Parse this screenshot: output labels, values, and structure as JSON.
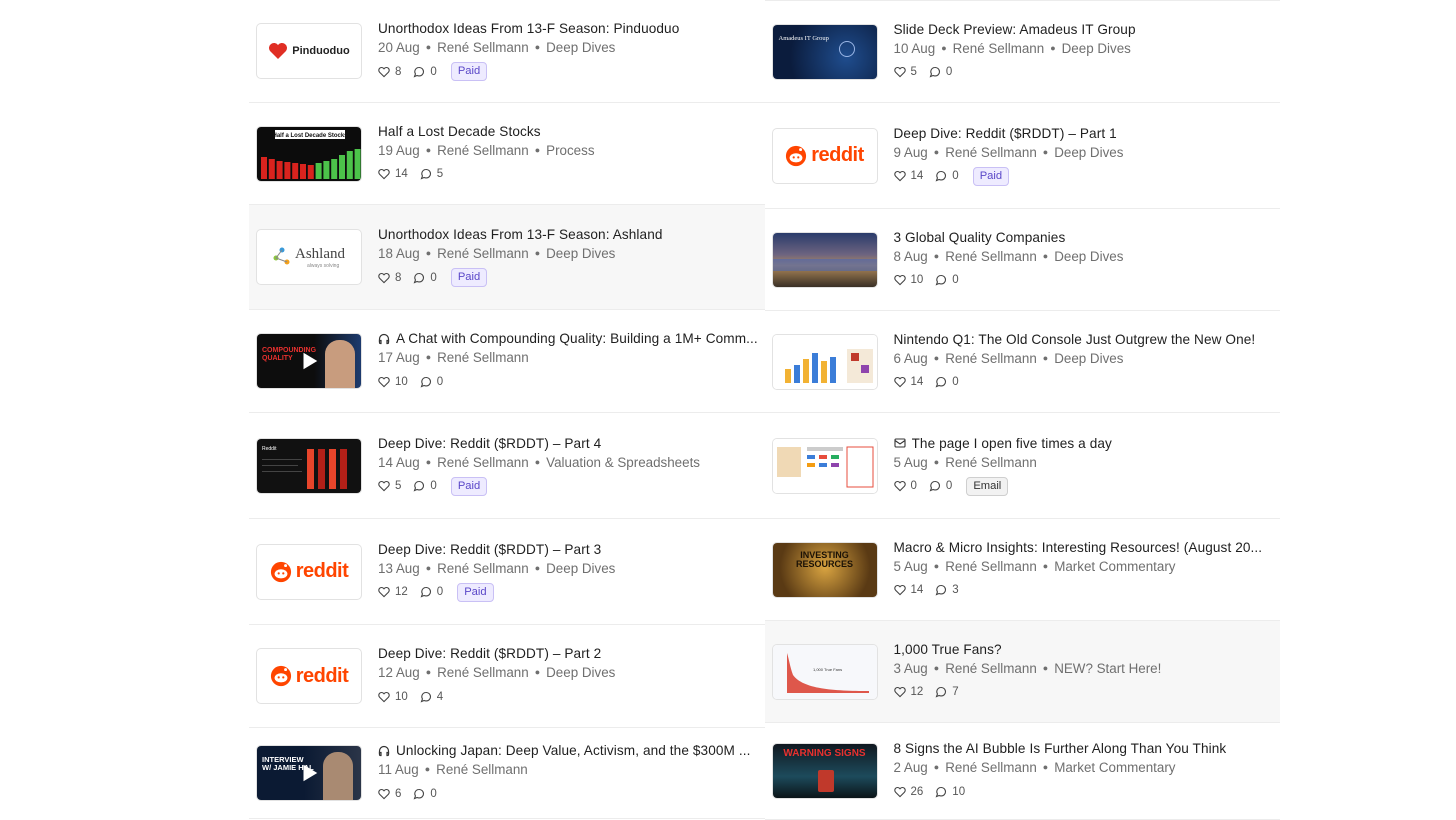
{
  "colors": {
    "paid_badge_bg": "#eeebff",
    "paid_badge_text": "#5a47c8",
    "reddit_orange": "#ff4500",
    "meta_text": "#6f6f6f"
  },
  "left_posts": [
    {
      "title": "Unorthodox Ideas From 13-F Season: Pinduoduo",
      "date": "20 Aug",
      "author": "René Sellmann",
      "section": "Deep Dives",
      "likes": "8",
      "comments": "0",
      "badge": "Paid",
      "thumb": "pinduoduo-logo",
      "logo_text": "Pinduoduo"
    },
    {
      "title": "Half a Lost Decade Stocks",
      "date": "19 Aug",
      "author": "René Sellmann",
      "section": "Process",
      "likes": "14",
      "comments": "5",
      "thumb": "lost-decade-chart",
      "logo_text": "Half a Lost Decade Stocks"
    },
    {
      "title": "Unorthodox Ideas From 13-F Season: Ashland",
      "date": "18 Aug",
      "author": "René Sellmann",
      "section": "Deep Dives",
      "likes": "8",
      "comments": "0",
      "badge": "Paid",
      "thumb": "ashland-logo",
      "logo_text": "Ashland",
      "logo_sub": "always solving"
    },
    {
      "title": "A Chat with Compounding Quality: Building a 1M+ Comm...",
      "date": "17 Aug",
      "author": "René Sellmann",
      "likes": "10",
      "comments": "0",
      "thumb": "compounding-quality-video",
      "logo_text": "COMPOUNDING QUALITY",
      "type_icon": "headphones-icon"
    },
    {
      "title": "Deep Dive: Reddit ($RDDT) – Part 4",
      "date": "14 Aug",
      "author": "René Sellmann",
      "section": "Valuation & Spreadsheets",
      "likes": "5",
      "comments": "0",
      "badge": "Paid",
      "thumb": "reddit-spreadsheet",
      "logo_text": "Reddit"
    },
    {
      "title": "Deep Dive: Reddit ($RDDT) – Part 3",
      "date": "13 Aug",
      "author": "René Sellmann",
      "section": "Deep Dives",
      "likes": "12",
      "comments": "0",
      "badge": "Paid",
      "thumb": "reddit-logo",
      "logo_text": "reddit"
    },
    {
      "title": "Deep Dive: Reddit ($RDDT) – Part 2",
      "date": "12 Aug",
      "author": "René Sellmann",
      "section": "Deep Dives",
      "likes": "10",
      "comments": "4",
      "thumb": "reddit-logo",
      "logo_text": "reddit"
    },
    {
      "title": "Unlocking Japan: Deep Value, Activism, and the $300M ...",
      "date": "11 Aug",
      "author": "René Sellmann",
      "likes": "6",
      "comments": "0",
      "thumb": "interview-video",
      "logo_text": "INTERVIEW W/ JAMIE HAL",
      "type_icon": "headphones-icon"
    }
  ],
  "right_posts": [
    {
      "title": "Slide Deck Preview: Amadeus IT Group",
      "date": "10 Aug",
      "author": "René Sellmann",
      "section": "Deep Dives",
      "likes": "5",
      "comments": "0",
      "thumb": "amadeus-slide",
      "logo_text": "Amadeus IT Group"
    },
    {
      "title": "Deep Dive: Reddit ($RDDT) – Part 1",
      "date": "9 Aug",
      "author": "René Sellmann",
      "section": "Deep Dives",
      "likes": "14",
      "comments": "0",
      "badge": "Paid",
      "thumb": "reddit-logo",
      "logo_text": "reddit"
    },
    {
      "title": "3 Global Quality Companies",
      "date": "8 Aug",
      "author": "René Sellmann",
      "section": "Deep Dives",
      "likes": "10",
      "comments": "0",
      "thumb": "city-collage"
    },
    {
      "title": "Nintendo Q1: The Old Console Just Outgrew the New One!",
      "date": "6 Aug",
      "author": "René Sellmann",
      "section": "Deep Dives",
      "likes": "14",
      "comments": "0",
      "thumb": "nintendo-chart"
    },
    {
      "title": "The page I open five times a day",
      "date": "5 Aug",
      "author": "René Sellmann",
      "likes": "0",
      "comments": "0",
      "badge": "Email",
      "thumb": "dashboard-screenshot",
      "type_icon": "mail-icon"
    },
    {
      "title": "Macro & Micro Insights: Interesting Resources! (August 20...",
      "date": "5 Aug",
      "author": "René Sellmann",
      "section": "Market Commentary",
      "likes": "14",
      "comments": "3",
      "thumb": "investing-resources",
      "logo_text": "INVESTING RESOURCES"
    },
    {
      "title": "1,000 True Fans?",
      "date": "3 Aug",
      "author": "René Sellmann",
      "section": "NEW? Start Here!",
      "likes": "12",
      "comments": "7",
      "thumb": "true-fans-chart",
      "logo_text": "1,000 True Fans"
    },
    {
      "title": "8 Signs the AI Bubble Is Further Along Than You Think",
      "date": "2 Aug",
      "author": "René Sellmann",
      "section": "Market Commentary",
      "likes": "26",
      "comments": "10",
      "thumb": "warning-signs",
      "logo_text": "WARNING SIGNS"
    }
  ]
}
